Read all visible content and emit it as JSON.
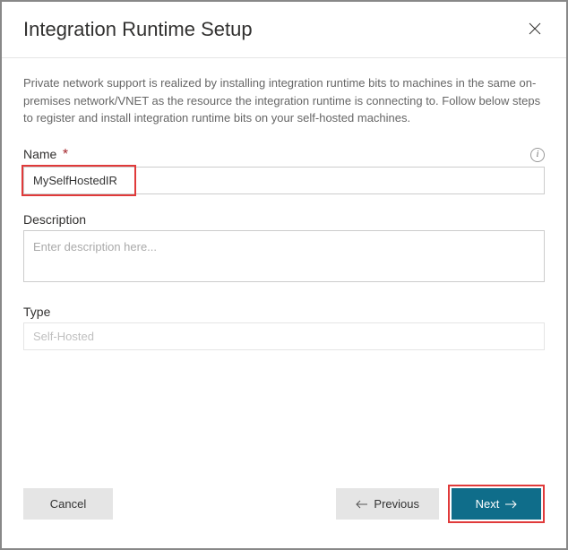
{
  "header": {
    "title": "Integration Runtime Setup"
  },
  "intro": "Private network support is realized by installing integration runtime bits to machines in the same on-premises network/VNET as the resource the integration runtime is connecting to. Follow below steps to register and install integration runtime bits on your self-hosted machines.",
  "fields": {
    "name": {
      "label": "Name",
      "value": "MySelfHostedIR"
    },
    "description": {
      "label": "Description",
      "placeholder": "Enter description here...",
      "value": ""
    },
    "type": {
      "label": "Type",
      "value": "Self-Hosted"
    }
  },
  "footer": {
    "cancel": "Cancel",
    "previous": "Previous",
    "next": "Next"
  }
}
